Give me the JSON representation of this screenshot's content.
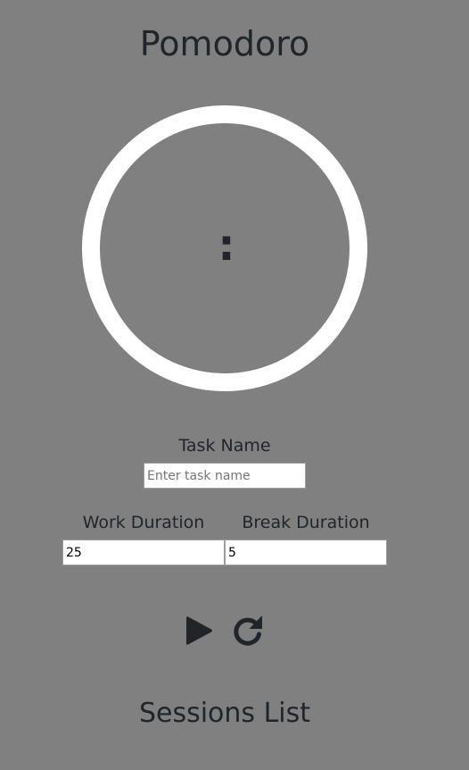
{
  "app": {
    "title": "Pomodoro"
  },
  "timer": {
    "minutes": "",
    "seconds": "",
    "separator": ":"
  },
  "task": {
    "label": "Task Name",
    "placeholder": "Enter task name",
    "value": ""
  },
  "work": {
    "label": "Work Duration",
    "value": "25"
  },
  "break_duration": {
    "label": "Break Duration",
    "value": "5"
  },
  "controls": {
    "play_icon": "play-icon",
    "reset_icon": "reset-icon"
  },
  "sessions": {
    "title": "Sessions List",
    "items": []
  },
  "colors": {
    "background": "#808080",
    "ring": "#ffffff",
    "text": "#212529"
  }
}
